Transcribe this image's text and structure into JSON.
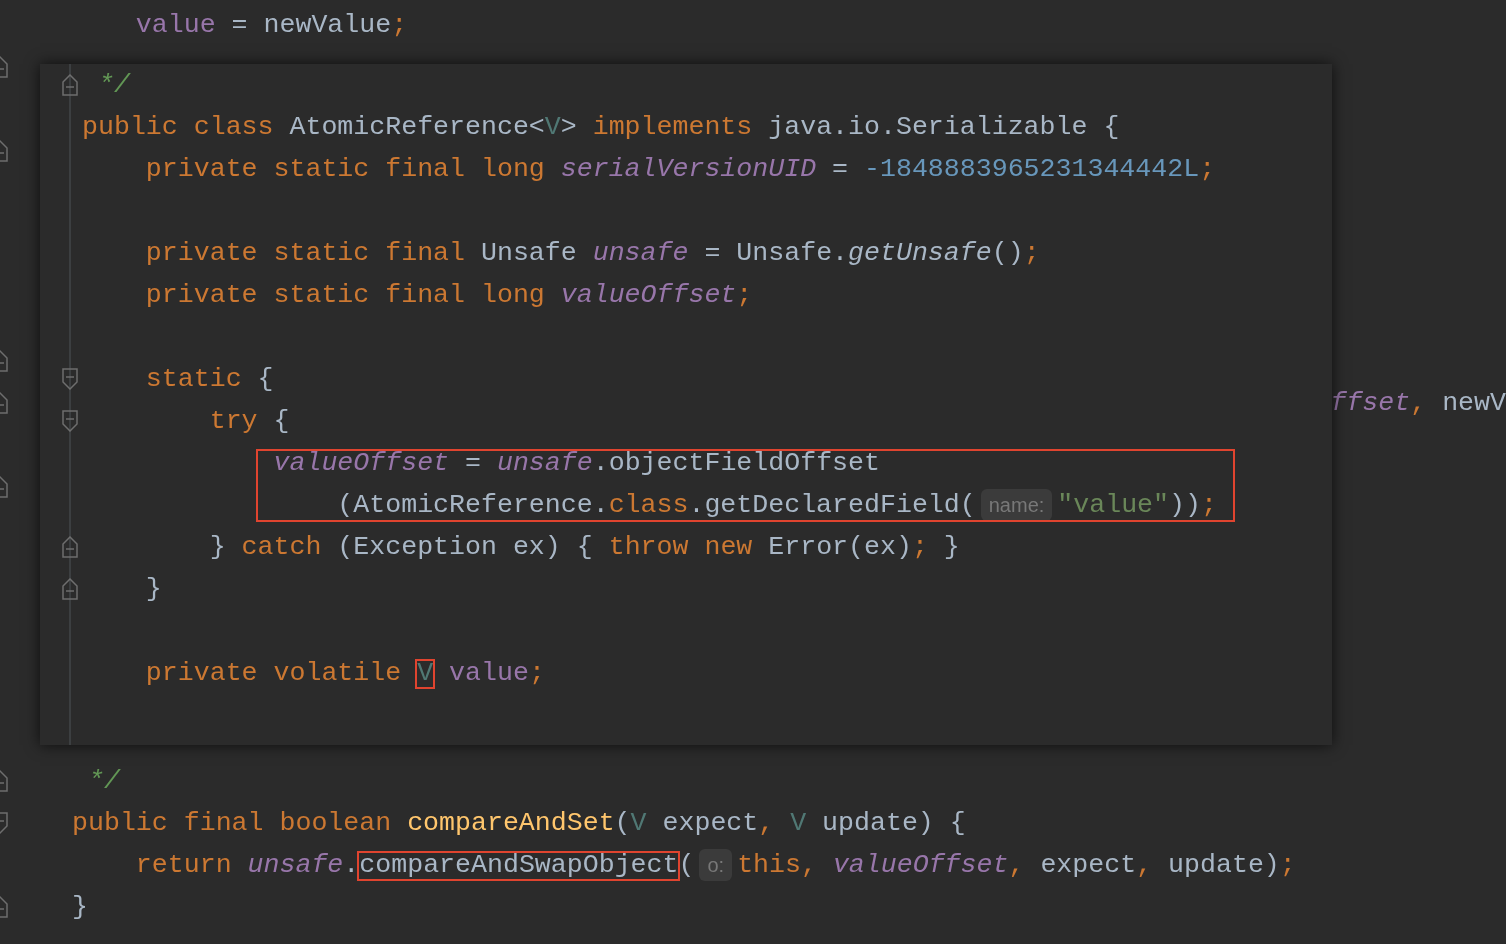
{
  "editor": {
    "lines": [
      {
        "kind": "code",
        "tokens": [
          {
            "text": "    value",
            "kind": "field"
          },
          {
            "text": " = newValue",
            "kind": "plain"
          },
          {
            "text": ";",
            "kind": "punct"
          }
        ]
      },
      {
        "kind": "blank",
        "fold_end": true
      },
      {
        "kind": "blank"
      },
      {
        "kind": "blank",
        "fold_end": true
      },
      {
        "kind": "blank"
      },
      {
        "kind": "blank"
      },
      {
        "kind": "blank"
      },
      {
        "kind": "blank"
      },
      {
        "kind": "blank",
        "fold_end": true
      },
      {
        "kind": "cut_left",
        "fold_end": true,
        "tokens": [
          {
            "text": "ffset",
            "kind": "static_field"
          },
          {
            "text": ",",
            "kind": "punct"
          },
          {
            "text": " newV",
            "kind": "plain"
          }
        ]
      },
      {
        "kind": "blank"
      },
      {
        "kind": "blank",
        "fold_end": true
      },
      {
        "kind": "blank"
      },
      {
        "kind": "blank"
      },
      {
        "kind": "blank"
      },
      {
        "kind": "blank"
      },
      {
        "kind": "blank"
      },
      {
        "kind": "blank"
      },
      {
        "kind": "code",
        "fold_end": true,
        "tokens": [
          {
            "text": " */",
            "kind": "comment"
          }
        ]
      },
      {
        "kind": "code",
        "fold_start": true,
        "tokens": [
          {
            "text": "public final boolean ",
            "kind": "keyword"
          },
          {
            "text": "compareAndSet",
            "kind": "method_decl"
          },
          {
            "text": "(",
            "kind": "plain"
          },
          {
            "text": "V",
            "kind": "type_param"
          },
          {
            "text": " expect",
            "kind": "plain"
          },
          {
            "text": ", ",
            "kind": "punct"
          },
          {
            "text": "V",
            "kind": "type_param"
          },
          {
            "text": " update) {",
            "kind": "plain"
          }
        ]
      },
      {
        "kind": "code",
        "tokens": [
          {
            "text": "    return ",
            "kind": "keyword"
          },
          {
            "text": "unsafe",
            "kind": "static_field"
          },
          {
            "text": ".",
            "kind": "plain"
          },
          {
            "text": "compareAndSwapObject",
            "kind": "plain",
            "boxed": true
          },
          {
            "text": "(",
            "kind": "plain"
          },
          {
            "text": "o:",
            "kind": "hint"
          },
          {
            "text": "this",
            "kind": "keyword"
          },
          {
            "text": ", ",
            "kind": "punct"
          },
          {
            "text": "valueOffset",
            "kind": "static_field"
          },
          {
            "text": ",",
            "kind": "punct"
          },
          {
            "text": " expect",
            "kind": "plain"
          },
          {
            "text": ",",
            "kind": "punct"
          },
          {
            "text": " update)",
            "kind": "plain"
          },
          {
            "text": ";",
            "kind": "punct"
          }
        ]
      },
      {
        "kind": "code",
        "fold_end": true,
        "tokens": [
          {
            "text": "}",
            "kind": "plain"
          }
        ]
      }
    ]
  },
  "popup": {
    "lines": [
      {
        "kind": "code",
        "fold_end": true,
        "tokens": [
          {
            "text": " */",
            "kind": "comment"
          }
        ]
      },
      {
        "kind": "code",
        "tokens": [
          {
            "text": "public class ",
            "kind": "keyword"
          },
          {
            "text": "AtomicReference<",
            "kind": "plain"
          },
          {
            "text": "V",
            "kind": "type_param"
          },
          {
            "text": "> ",
            "kind": "plain"
          },
          {
            "text": "implements ",
            "kind": "keyword"
          },
          {
            "text": "java.io.Serializable {",
            "kind": "plain"
          }
        ]
      },
      {
        "kind": "code",
        "tokens": [
          {
            "text": "    private static final long ",
            "kind": "keyword"
          },
          {
            "text": "serialVersionUID",
            "kind": "static_field"
          },
          {
            "text": " = ",
            "kind": "plain"
          },
          {
            "text": "-1848883965231344442L",
            "kind": "number"
          },
          {
            "text": ";",
            "kind": "punct"
          }
        ]
      },
      {
        "kind": "blank"
      },
      {
        "kind": "code",
        "tokens": [
          {
            "text": "    private static final ",
            "kind": "keyword"
          },
          {
            "text": "Unsafe ",
            "kind": "plain"
          },
          {
            "text": "unsafe",
            "kind": "static_field"
          },
          {
            "text": " = Unsafe.",
            "kind": "plain"
          },
          {
            "text": "getUnsafe",
            "kind": "static_call"
          },
          {
            "text": "()",
            "kind": "plain"
          },
          {
            "text": ";",
            "kind": "punct"
          }
        ]
      },
      {
        "kind": "code",
        "tokens": [
          {
            "text": "    private static final long ",
            "kind": "keyword"
          },
          {
            "text": "valueOffset",
            "kind": "static_field"
          },
          {
            "text": ";",
            "kind": "punct"
          }
        ]
      },
      {
        "kind": "blank"
      },
      {
        "kind": "code",
        "fold_start": true,
        "tokens": [
          {
            "text": "    static ",
            "kind": "keyword"
          },
          {
            "text": "{",
            "kind": "plain"
          }
        ]
      },
      {
        "kind": "code",
        "fold_start": true,
        "tokens": [
          {
            "text": "        try ",
            "kind": "keyword"
          },
          {
            "text": "{",
            "kind": "plain"
          }
        ]
      },
      {
        "kind": "code",
        "boxed": true,
        "tokens": [
          {
            "text": "            valueOffset",
            "kind": "static_field"
          },
          {
            "text": " = ",
            "kind": "plain"
          },
          {
            "text": "unsafe",
            "kind": "static_field"
          },
          {
            "text": ".objectFieldOffset",
            "kind": "plain"
          }
        ]
      },
      {
        "kind": "code",
        "boxed": true,
        "tokens": [
          {
            "text": "                (AtomicReference.",
            "kind": "plain"
          },
          {
            "text": "class",
            "kind": "keyword"
          },
          {
            "text": ".getDeclaredField(",
            "kind": "plain"
          },
          {
            "text": "name:",
            "kind": "hint"
          },
          {
            "text": "\"value\"",
            "kind": "string"
          },
          {
            "text": "))",
            "kind": "plain"
          },
          {
            "text": ";",
            "kind": "punct"
          }
        ]
      },
      {
        "kind": "code",
        "fold_end": true,
        "tokens": [
          {
            "text": "        } ",
            "kind": "plain"
          },
          {
            "text": "catch ",
            "kind": "keyword"
          },
          {
            "text": "(Exception ex) { ",
            "kind": "plain"
          },
          {
            "text": "throw new ",
            "kind": "keyword"
          },
          {
            "text": "Error(ex)",
            "kind": "plain"
          },
          {
            "text": ";",
            "kind": "punct"
          },
          {
            "text": " }",
            "kind": "plain"
          }
        ]
      },
      {
        "kind": "code",
        "fold_end": true,
        "tokens": [
          {
            "text": "    }",
            "kind": "plain"
          }
        ]
      },
      {
        "kind": "blank"
      },
      {
        "kind": "code",
        "tokens": [
          {
            "text": "    private volatile ",
            "kind": "keyword"
          },
          {
            "text": "V",
            "kind": "type_param",
            "boxed": true
          },
          {
            "text": " value",
            "kind": "field"
          },
          {
            "text": ";",
            "kind": "punct"
          }
        ]
      },
      {
        "kind": "blank"
      }
    ]
  }
}
